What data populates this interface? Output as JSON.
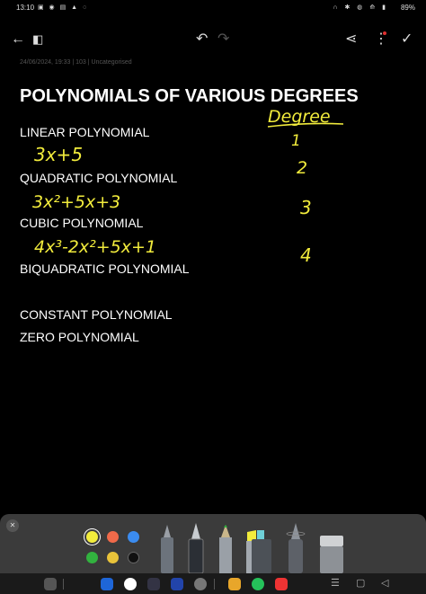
{
  "status_bar": {
    "time": "13:10",
    "left_icons": "▣ ◉ ▤ ▲ ◌",
    "right_icons": "∩ ✱ ◍ ⟰ ▮",
    "battery": "89%"
  },
  "toolbar": {
    "back_icon": "←",
    "panel_icon": "◧",
    "undo_icon": "↶",
    "redo_icon": "↷",
    "share_icon": "⋖",
    "more_icon": "⋮",
    "done_icon": "✓"
  },
  "note": {
    "meta": "24/06/2024, 19:33  |  103  |  Uncategorised",
    "title": "POLYNOMIALS OF VARIOUS DEGREES",
    "sections": [
      "LINEAR POLYNOMIAL",
      "QUADRATIC POLYNOMIAL",
      "CUBIC POLYNOMIAL",
      "BIQUADRATIC POLYNOMIAL",
      "CONSTANT POLYNOMIAL",
      "ZERO POLYNOMIAL"
    ],
    "handwriting": {
      "degree_heading": "Degree",
      "linear_expr": "3x+5",
      "quadratic_expr": "3x²+5x+3",
      "cubic_expr": "4x³-2x²+5x+1",
      "degrees": [
        "1",
        "2",
        "3",
        "4"
      ]
    }
  },
  "pen_panel": {
    "close_icon": "✕",
    "colors": [
      "#f2ec3c",
      "#f06a4a",
      "#3b8cf0",
      "#32b23f",
      "#e9c33a",
      "#111111"
    ]
  },
  "nav_bar": {
    "recents_icon": "☰",
    "home_icon": "▢",
    "back_icon": "◁"
  }
}
